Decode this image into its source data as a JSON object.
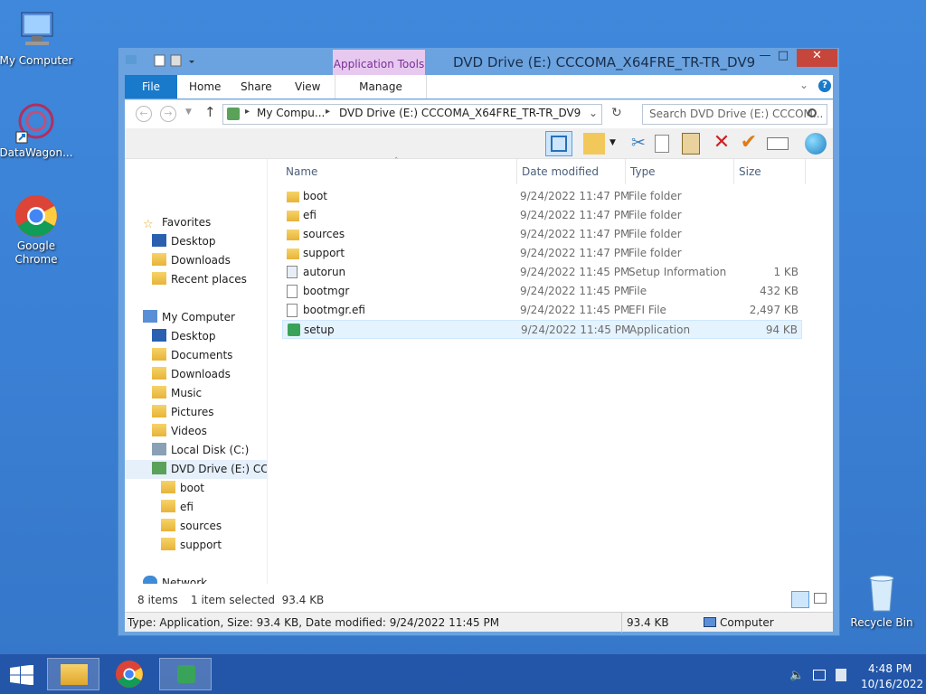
{
  "desktop": {
    "icons": [
      {
        "label": "My Computer"
      },
      {
        "label": "DataWagon..."
      },
      {
        "label": "Google Chrome"
      },
      {
        "label": "Recycle Bin"
      }
    ]
  },
  "window": {
    "title": "DVD Drive (E:) CCCOMA_X64FRE_TR-TR_DV9",
    "app_tools": "Application Tools",
    "ribbon_tabs": [
      "File",
      "Home",
      "Share",
      "View",
      "Manage"
    ],
    "address": {
      "crumb1": "My Compu...",
      "crumb2": "DVD Drive (E:) CCCOMA_X64FRE_TR-TR_DV9"
    },
    "search_placeholder": "Search DVD Drive (E:) CCCOM...",
    "columns": {
      "name": "Name",
      "date": "Date modified",
      "type": "Type",
      "size": "Size"
    },
    "files": [
      {
        "name": "boot",
        "date": "9/24/2022 11:47 PM",
        "type": "File folder",
        "size": "",
        "icon": "folder-icon"
      },
      {
        "name": "efi",
        "date": "9/24/2022 11:47 PM",
        "type": "File folder",
        "size": "",
        "icon": "folder-icon"
      },
      {
        "name": "sources",
        "date": "9/24/2022 11:47 PM",
        "type": "File folder",
        "size": "",
        "icon": "folder-icon"
      },
      {
        "name": "support",
        "date": "9/24/2022 11:47 PM",
        "type": "File folder",
        "size": "",
        "icon": "folder-icon"
      },
      {
        "name": "autorun",
        "date": "9/24/2022 11:45 PM",
        "type": "Setup Information",
        "size": "1 KB",
        "icon": "setup-info-icon"
      },
      {
        "name": "bootmgr",
        "date": "9/24/2022 11:45 PM",
        "type": "File",
        "size": "432 KB",
        "icon": "file-icon"
      },
      {
        "name": "bootmgr.efi",
        "date": "9/24/2022 11:45 PM",
        "type": "EFI File",
        "size": "2,497 KB",
        "icon": "file-icon"
      },
      {
        "name": "setup",
        "date": "9/24/2022 11:45 PM",
        "type": "Application",
        "size": "94 KB",
        "icon": "setup-app-icon"
      }
    ],
    "nav": {
      "favorites": "Favorites",
      "fav_items": [
        "Desktop",
        "Downloads",
        "Recent places"
      ],
      "computer": "My Computer",
      "comp_items": [
        "Desktop",
        "Documents",
        "Downloads",
        "Music",
        "Pictures",
        "Videos",
        "Local Disk (C:)",
        "DVD Drive (E:) CCCC"
      ],
      "dvd_items": [
        "boot",
        "efi",
        "sources",
        "support"
      ],
      "network": "Network"
    },
    "info": {
      "items": "8 items",
      "selected": "1 item selected  93.4 KB"
    },
    "status": {
      "details": "Type: Application, Size: 93.4 KB, Date modified: 9/24/2022 11:45 PM",
      "size": "93.4 KB",
      "location": "Computer"
    }
  },
  "taskbar": {
    "time": "4:48 PM",
    "date": "10/16/2022"
  },
  "colors": {
    "accent": "#1979ca",
    "app_tools": "#e7c9f0",
    "close": "#c7463c"
  }
}
